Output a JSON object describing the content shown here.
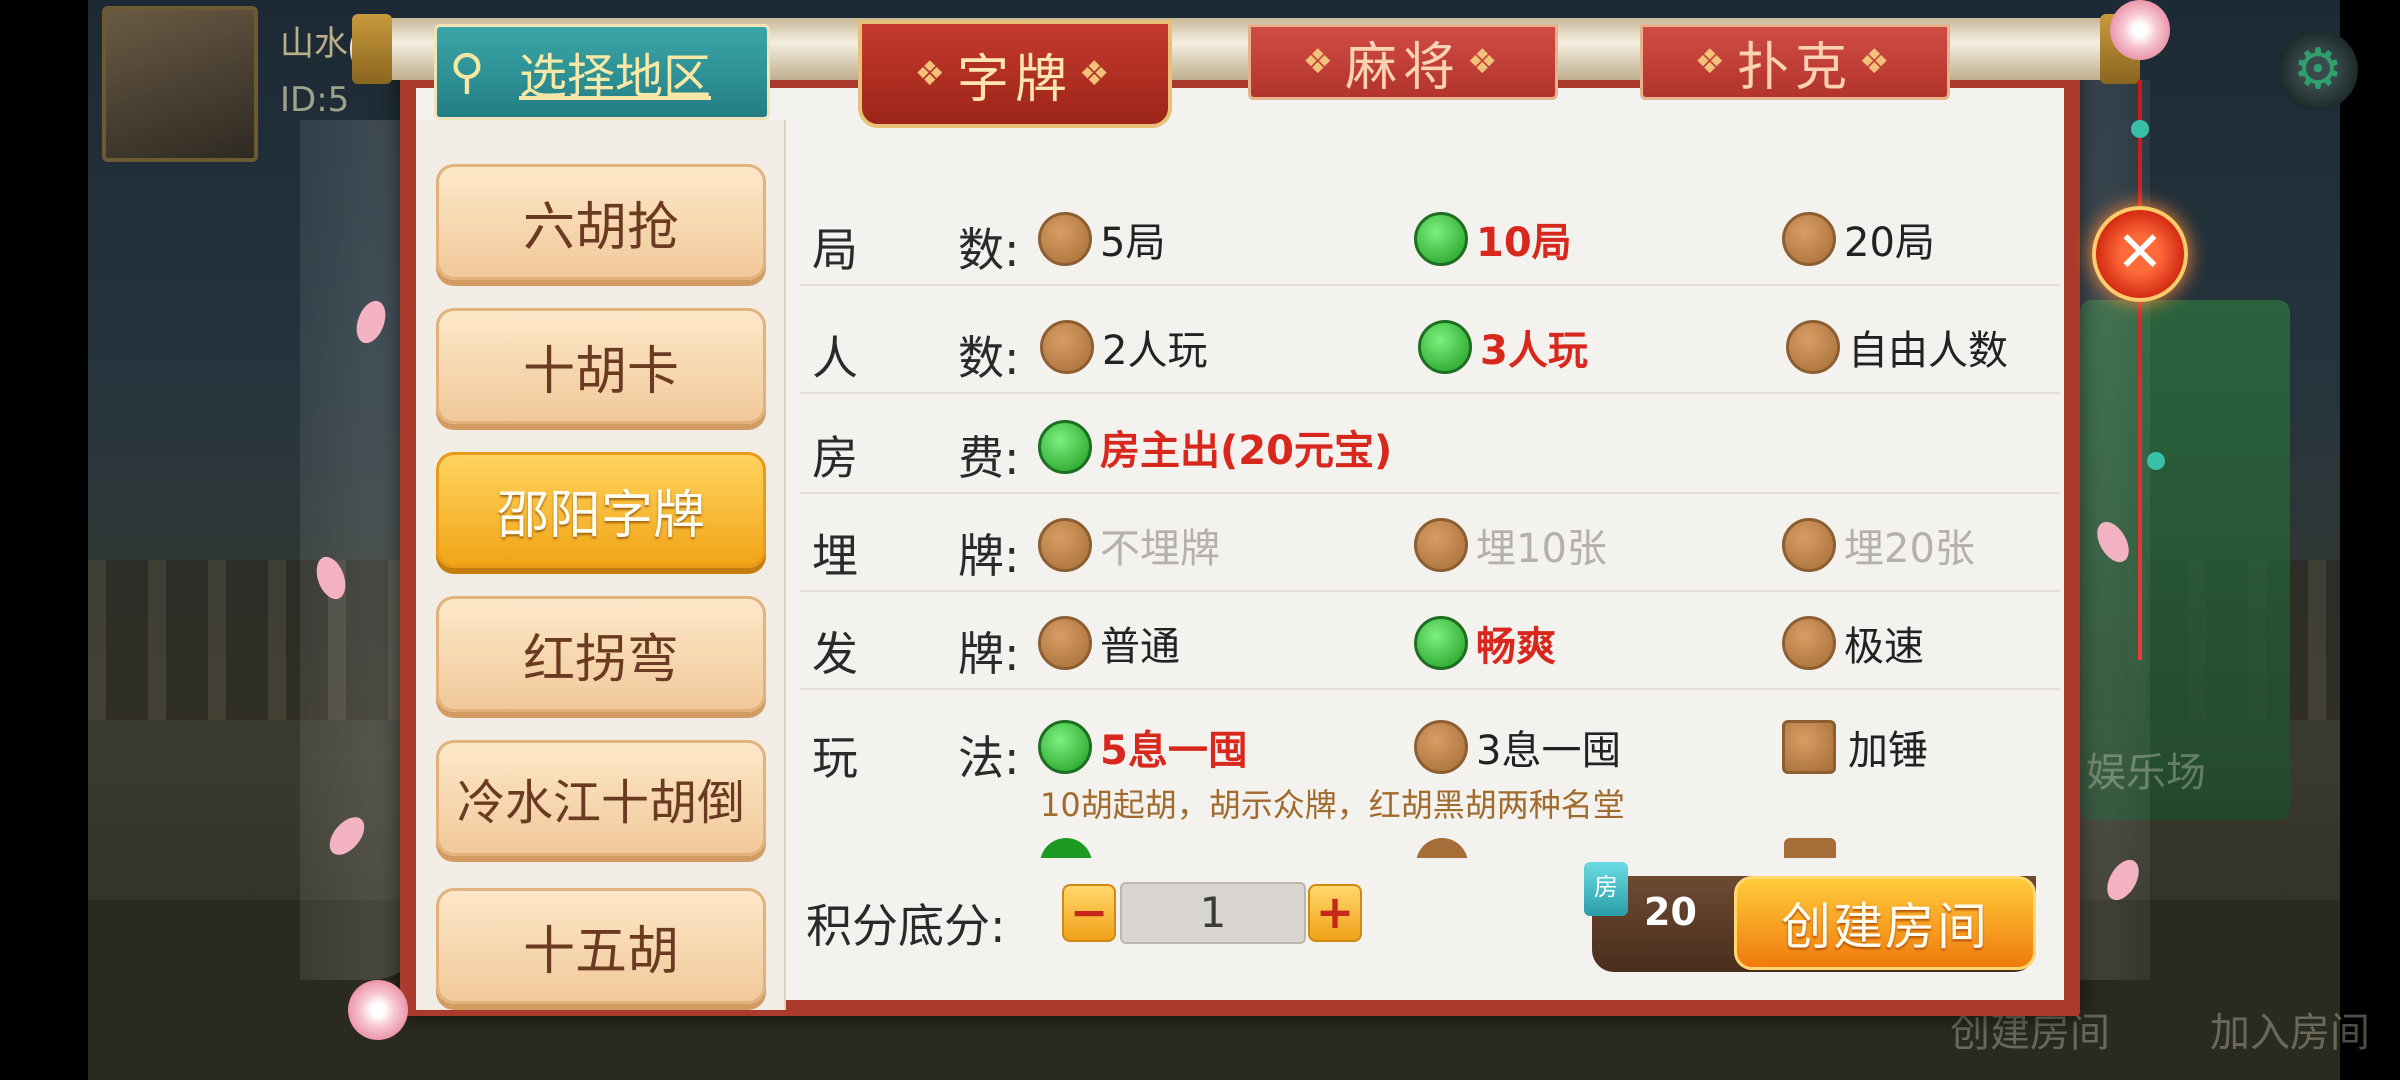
{
  "background": {
    "player_name": "山水",
    "player_id": "ID:5",
    "labels": {
      "entertainment": "娱乐场",
      "join_room": "加入房间",
      "create_room_bg": "创建房间"
    }
  },
  "region_selector": {
    "label": "选择地区",
    "icon": "location-pin-icon"
  },
  "tabs": [
    {
      "label": "字牌",
      "active": true
    },
    {
      "label": "麻将",
      "active": false
    },
    {
      "label": "扑克",
      "active": false
    }
  ],
  "games": [
    {
      "label": "六胡抢",
      "active": false
    },
    {
      "label": "十胡卡",
      "active": false
    },
    {
      "label": "邵阳字牌",
      "active": true
    },
    {
      "label": "红拐弯",
      "active": false
    },
    {
      "label": "冷水江十胡倒",
      "active": false
    },
    {
      "label": "十五胡",
      "active": false
    }
  ],
  "settings": {
    "rounds": {
      "k1": "局",
      "k2": "数:",
      "options": [
        "5局",
        "10局",
        "20局"
      ],
      "selected": 1
    },
    "players": {
      "k1": "人",
      "k2": "数:",
      "options": [
        "2人玩",
        "3人玩",
        "自由人数"
      ],
      "selected": 1
    },
    "fee": {
      "k1": "房",
      "k2": "费:",
      "options": [
        "房主出(20元宝)"
      ],
      "selected": 0
    },
    "bury": {
      "k1": "埋",
      "k2": "牌:",
      "options": [
        "不埋牌",
        "埋10张",
        "埋20张"
      ],
      "disabled": true
    },
    "deal": {
      "k1": "发",
      "k2": "牌:",
      "options": [
        "普通",
        "畅爽",
        "极速"
      ],
      "selected": 1
    },
    "play": {
      "k1": "玩",
      "k2": "法:",
      "options": [
        "5息一囤",
        "3息一囤",
        "加锤"
      ],
      "selected": 0,
      "note": "10胡起胡，胡示众牌，红胡黑胡两种名堂"
    }
  },
  "score": {
    "label": "积分底分:",
    "value": "1",
    "minus": "−",
    "plus": "+"
  },
  "create": {
    "room_tag": "房",
    "cost": "20",
    "button": "创建房间"
  },
  "close_label": "✕",
  "colors": {
    "selected_text": "#d8271c",
    "panel_red": "#a93a2c",
    "accent_orange": "#f07a0e"
  }
}
